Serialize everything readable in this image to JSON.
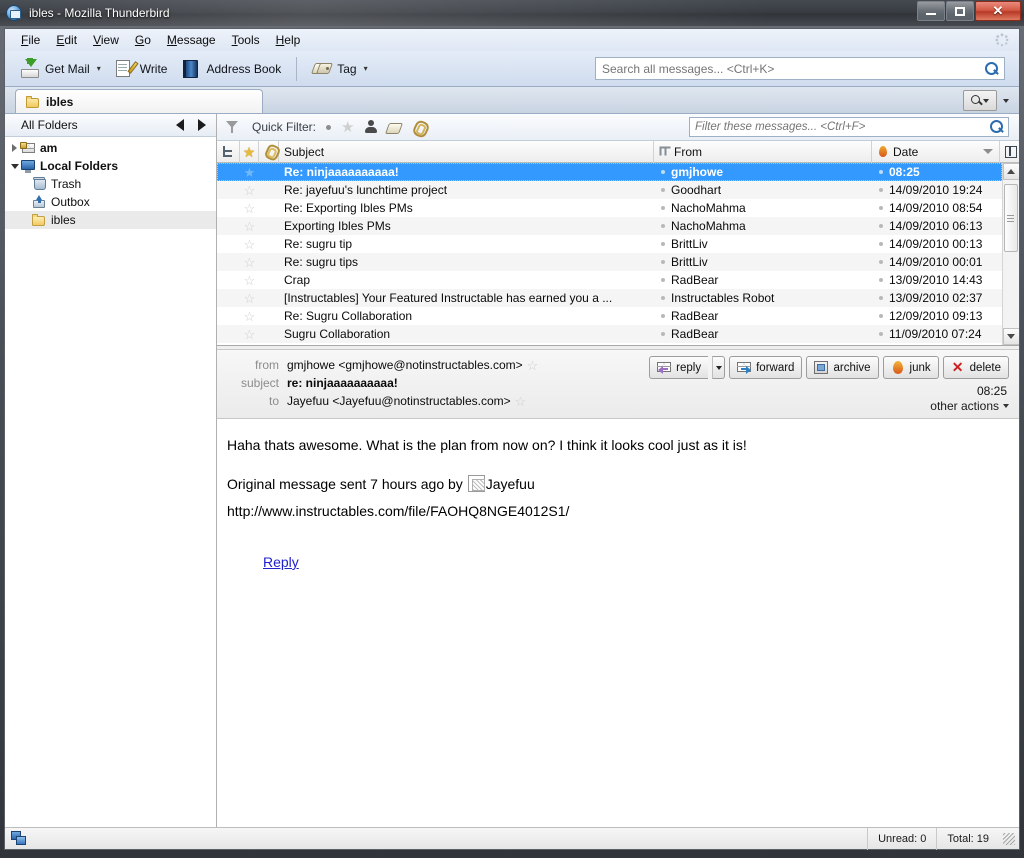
{
  "window": {
    "title": "ibles - Mozilla Thunderbird",
    "app_icon": "thunderbird-icon",
    "minimize_label": "Minimize",
    "maximize_label": "Maximize",
    "close_label": "✕"
  },
  "menubar": {
    "items": [
      {
        "label": "File",
        "accel": "F"
      },
      {
        "label": "Edit",
        "accel": "E"
      },
      {
        "label": "View",
        "accel": "V"
      },
      {
        "label": "Go",
        "accel": "G"
      },
      {
        "label": "Message",
        "accel": "M"
      },
      {
        "label": "Tools",
        "accel": "T"
      },
      {
        "label": "Help",
        "accel": "H"
      }
    ]
  },
  "toolbar": {
    "get_mail_label": "Get Mail",
    "write_label": "Write",
    "address_book_label": "Address Book",
    "tag_label": "Tag",
    "search_placeholder": "Search all messages... <Ctrl+K>",
    "search_value": ""
  },
  "tabbar": {
    "tab_label": "ibles"
  },
  "folder_pane": {
    "header": "All Folders",
    "items": [
      {
        "label": "am",
        "icon": "account-icon",
        "indent": 0,
        "twisty": "collapsed",
        "bold": true,
        "selected": false
      },
      {
        "label": "Local Folders",
        "icon": "local-folders-icon",
        "indent": 0,
        "twisty": "expanded",
        "bold": true,
        "selected": false
      },
      {
        "label": "Trash",
        "icon": "trash-icon",
        "indent": 1,
        "twisty": "none",
        "bold": false,
        "selected": false
      },
      {
        "label": "Outbox",
        "icon": "outbox-icon",
        "indent": 1,
        "twisty": "none",
        "bold": false,
        "selected": false
      },
      {
        "label": "ibles",
        "icon": "folder-icon",
        "indent": 1,
        "twisty": "none",
        "bold": false,
        "selected": true
      }
    ]
  },
  "quick_filter": {
    "label": "Quick Filter:",
    "filter_placeholder": "Filter these messages... <Ctrl+F>",
    "filter_value": "",
    "buttons": [
      "unread-dot-icon",
      "star-icon",
      "contact-icon",
      "tag-icon",
      "attachment-icon"
    ]
  },
  "message_list": {
    "columns": {
      "thread": "thread-icon",
      "star": "star-icon",
      "attachment": "attachment-icon",
      "subject": "Subject",
      "from_icon": "thread-link-icon",
      "from": "From",
      "date_icon": "flame-icon",
      "date": "Date",
      "picker": "column-picker-icon"
    },
    "sort": "descending",
    "rows": [
      {
        "subject": "Re: ninjaaaaaaaaaa!",
        "from": "gmjhowe",
        "date": "08:25",
        "selected": true
      },
      {
        "subject": "Re: jayefuu's lunchtime project",
        "from": "Goodhart",
        "date": "14/09/2010 19:24",
        "selected": false
      },
      {
        "subject": "Re: Exporting Ibles PMs",
        "from": "NachoMahma",
        "date": "14/09/2010 08:54",
        "selected": false
      },
      {
        "subject": "Exporting Ibles PMs",
        "from": "NachoMahma",
        "date": "14/09/2010 06:13",
        "selected": false
      },
      {
        "subject": "Re: sugru tip",
        "from": "BrittLiv",
        "date": "14/09/2010 00:13",
        "selected": false
      },
      {
        "subject": "Re: sugru tips",
        "from": "BrittLiv",
        "date": "14/09/2010 00:01",
        "selected": false
      },
      {
        "subject": "Crap",
        "from": "RadBear",
        "date": "13/09/2010 14:43",
        "selected": false
      },
      {
        "subject": "[Instructables] Your Featured Instructable has earned you a ...",
        "from": "Instructables Robot",
        "date": "13/09/2010 02:37",
        "selected": false
      },
      {
        "subject": "Re: Sugru Collaboration",
        "from": "RadBear",
        "date": "12/09/2010 09:13",
        "selected": false
      },
      {
        "subject": "Sugru Collaboration",
        "from": "RadBear",
        "date": "11/09/2010 07:24",
        "selected": false
      }
    ]
  },
  "reader": {
    "from_label": "from",
    "from_value": "gmjhowe <gmjhowe@notinstructables.com>",
    "subject_label": "subject",
    "subject_value": "re: ninjaaaaaaaaaa!",
    "to_label": "to",
    "to_value": "Jayefuu <Jayefuu@notinstructables.com>",
    "time": "08:25",
    "other_actions": "other actions",
    "buttons": {
      "reply": "reply",
      "forward": "forward",
      "archive": "archive",
      "junk": "junk",
      "delete": "delete"
    },
    "body": {
      "line1": "Haha thats awesome. What is the plan from now on? I think it looks cool just as it is!",
      "line2_prefix": "Original message sent 7 hours ago by ",
      "line2_suffix": "Jayefuu",
      "line3": "http://www.instructables.com/file/FAOHQ8NGE4012S1/",
      "reply_link": "Reply"
    }
  },
  "statusbar": {
    "unread": "Unread: 0",
    "total": "Total: 19"
  },
  "colors": {
    "selection_blue": "#3399ff",
    "link_blue": "#2222cc",
    "title_gradient_top": "#3f444b",
    "toolbar_blue": "#cfdcee"
  }
}
